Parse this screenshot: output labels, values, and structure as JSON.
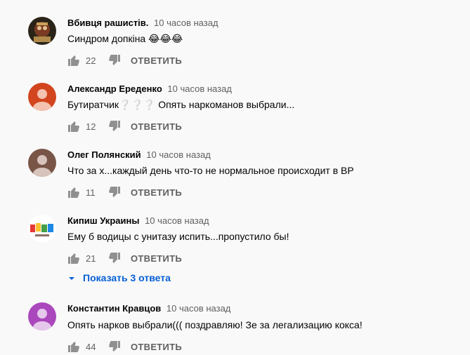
{
  "comments": [
    {
      "author": "Вбивця рашистів.",
      "time": "10 часов назад",
      "text": "Синдром допкіна 😂😂😂",
      "likes": "22",
      "reply_label": "ОТВЕТИТЬ",
      "avatar_color": "#3a3020"
    },
    {
      "author": "Александр Ереденко",
      "time": "10 часов назад",
      "text": "Бутиратчик❔❔❔ Опять наркоманов выбрали...",
      "likes": "12",
      "reply_label": "ОТВЕТИТЬ",
      "avatar_color": "#d2451e"
    },
    {
      "author": "Олег Полянский",
      "time": "10 часов назад",
      "text": "Что за х...каждый день  что-то не нормальное происходит в ВР",
      "likes": "11",
      "reply_label": "ОТВЕТИТЬ",
      "avatar_color": "#795548"
    },
    {
      "author": "Кипиш Украины",
      "time": "10 часов назад",
      "text": "Ему б водицы с унитазу испить...пропустило бы!",
      "likes": "21",
      "reply_label": "ОТВЕТИТЬ",
      "avatar_color": "#ffffff"
    },
    {
      "author": "Константин Кравцов",
      "time": "10 часов назад",
      "text": "Опять нарков выбрали((( поздравляю! Зе за легализацию кокса!",
      "likes": "44",
      "reply_label": "ОТВЕТИТЬ",
      "avatar_color": "#ab47bc"
    }
  ],
  "show_replies_label": "Показать 3 ответа",
  "colors": {
    "link": "#065fd4",
    "secondary_text": "#606060",
    "icon": "#909090"
  }
}
